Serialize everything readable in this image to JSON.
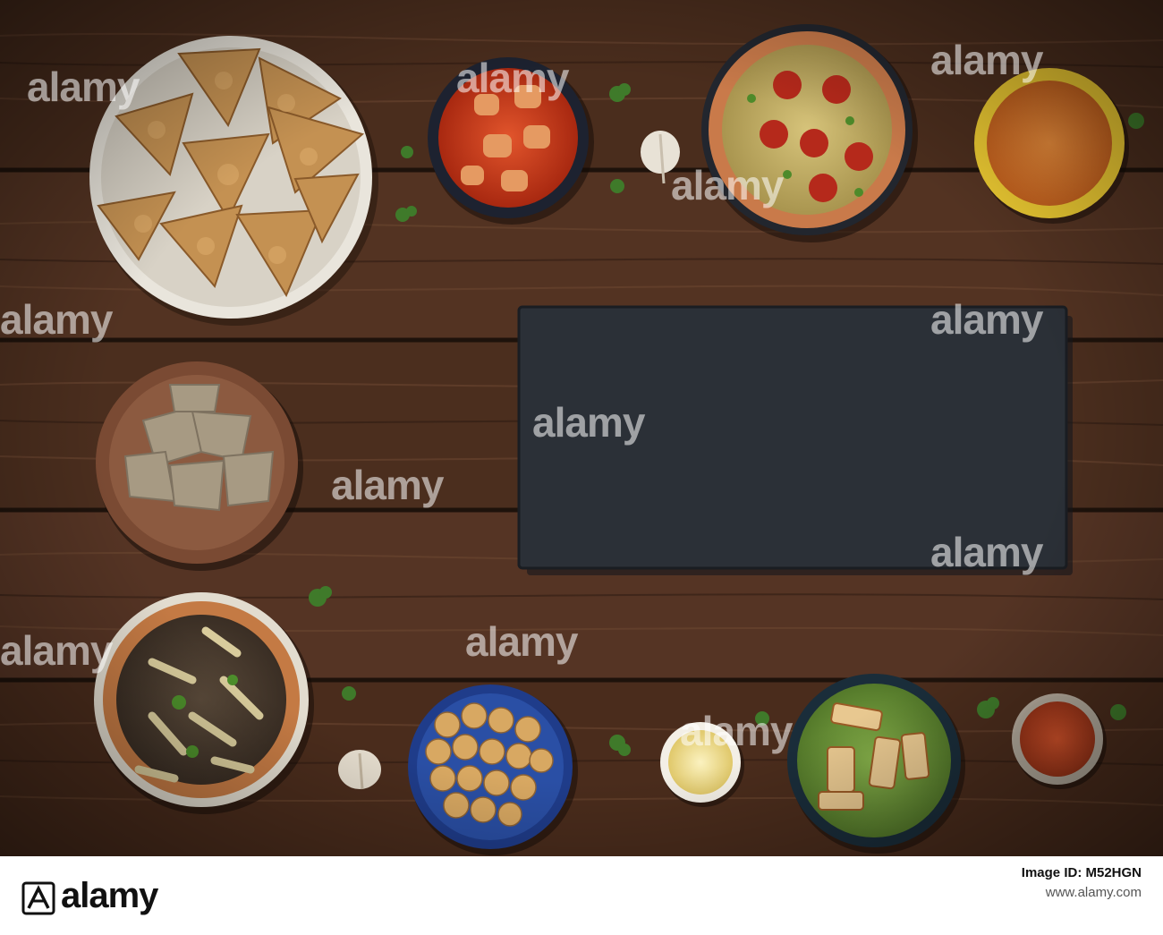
{
  "photo": {
    "colors": {
      "wood_dark": "#2b1a12",
      "wood_mid": "#4a2c1c",
      "wood_light": "#6b4530",
      "slate": "#2a2f36",
      "curry_red": "#c8361b",
      "lentil_orange": "#d9782a",
      "palak_green": "#6f9a3a",
      "spice_red": "#b8431f",
      "ghee": "#f0e3a0"
    },
    "dishes": [
      {
        "name": "samosas",
        "icon": "samosa-plate-icon"
      },
      {
        "name": "curry",
        "icon": "red-curry-bowl-icon"
      },
      {
        "name": "millet-salad",
        "icon": "millet-bowl-icon"
      },
      {
        "name": "red-lentils",
        "icon": "lentil-bowl-icon"
      },
      {
        "name": "halva",
        "icon": "halva-bowl-icon"
      },
      {
        "name": "lentils-beans",
        "icon": "lentil-bean-bowl-icon"
      },
      {
        "name": "chickpeas",
        "icon": "chickpea-bowl-icon"
      },
      {
        "name": "ghee",
        "icon": "ghee-bowl-icon"
      },
      {
        "name": "palak-paneer",
        "icon": "palak-paneer-bowl-icon"
      },
      {
        "name": "spice",
        "icon": "spice-bowl-icon"
      }
    ],
    "watermarks": [
      "alamy",
      "alamy",
      "alamy",
      "alamy",
      "alamy",
      "alamy",
      "alamy",
      "alamy",
      "alamy",
      "alamy",
      "alamy",
      "alamy"
    ]
  },
  "footer": {
    "logo_text": "alamy",
    "image_id_label": "Image ID: M52HGN",
    "site": "www.alamy.com"
  }
}
